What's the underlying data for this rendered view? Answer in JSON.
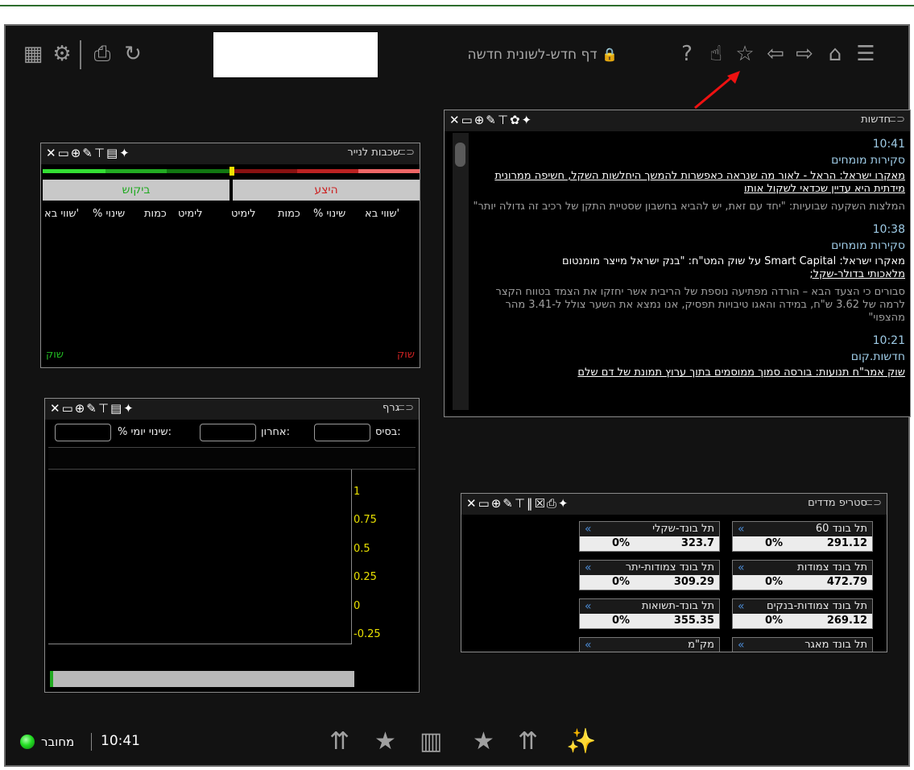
{
  "toolbar": {
    "page_title": "דף חדש-לשונית חדשה",
    "icons_left": [
      "grid-icon",
      "gear-icon",
      "bag-icon",
      "share-icon"
    ],
    "icons_right": [
      "help-icon",
      "thumbs-up-icon",
      "star-icon",
      "back-icon",
      "forward-icon",
      "home-icon",
      "menu-icon"
    ]
  },
  "depth": {
    "title": "שכבות לנייר",
    "bid_label": "ביקוש",
    "ask_label": "היצע",
    "columns": [
      "שווי בא'",
      "% שינוי",
      "כמות",
      "לימיט",
      "לימיט",
      "כמות",
      "% שינוי",
      "שווי בא'"
    ],
    "market_left": "שוק",
    "market_right": "שוק"
  },
  "graph": {
    "title": "גרף",
    "base_label": "בסיס:",
    "last_label": "אחרון:",
    "daily_change_label": "% שינוי יומי:",
    "y_ticks": [
      "1",
      "0.75",
      "0.5",
      "0.25",
      "0",
      "-0.25"
    ]
  },
  "news": {
    "title": "חדשות",
    "items": [
      {
        "time": "10:41",
        "category": "סקירות מומחים",
        "headline": "מאקרו ישראל: הראל - לאור מה שנראה כאפשרות להמשך היחלשות השקל, חשיפה ממרונית מידתית היא עדיין שכדאי לשקול אותו",
        "summary": "המלצות השקעה שבועיות: \"יחד עם זאת, יש להביא בחשבון שסטיית התקן של רכיב זה גדולה יותר\""
      },
      {
        "time": "10:38",
        "category": "סקירות מומחים",
        "headline_plain": "מאקרו ישראל: Smart Capital על שוק המט\"ח: \"בנק ישראל מייצר מומנטום",
        "headline_underlined": "מלאכותי בדולר-שקל;",
        "summary": "סבורים כי הצעד הבא – הורדה מפתיעה נוספת של הריבית אשר יחזקו את הצמד בטווח הקצר לרמה של 3.62 ש\"ח, במידה והאגו טיבויות תפסיק, אנו נמצא את השער צולל ל-3.41 מהר מהצפוי\""
      },
      {
        "time": "10:21",
        "category": "חדשות.קום",
        "headline": "שוק אמר\"ח תנועות: בורסה סמוך ממוסמים בתוך ערוץ תמונת של דם שלם"
      }
    ]
  },
  "indices": {
    "title": "סטריפ מדדים",
    "tiles": [
      {
        "name": "תל בונד 60",
        "change": "0%",
        "price": "291.12"
      },
      {
        "name": "תל בונד-שקלי",
        "change": "0%",
        "price": "323.7"
      },
      {
        "name": "תל בונד צמודות",
        "change": "0%",
        "price": "472.79"
      },
      {
        "name": "תל בונד צמודות-יתר",
        "change": "0%",
        "price": "309.29"
      },
      {
        "name": "תל בונד צמודות-בנקים",
        "change": "0%",
        "price": "269.12"
      },
      {
        "name": "תל בונד-תשואות",
        "change": "0%",
        "price": "355.35"
      },
      {
        "name": "תל בונד מאגר",
        "change": "",
        "price": ""
      },
      {
        "name": "מק\"מ",
        "change": "",
        "price": ""
      }
    ]
  },
  "status": {
    "connection_label": "מחובר",
    "time": "10:41"
  },
  "colors": {
    "accent_blue": "#9ecbe6",
    "connected_green": "#22dd22",
    "ask_red": "#cc2222",
    "bid_green": "#22bb22",
    "axis_yellow": "#e8e000"
  }
}
